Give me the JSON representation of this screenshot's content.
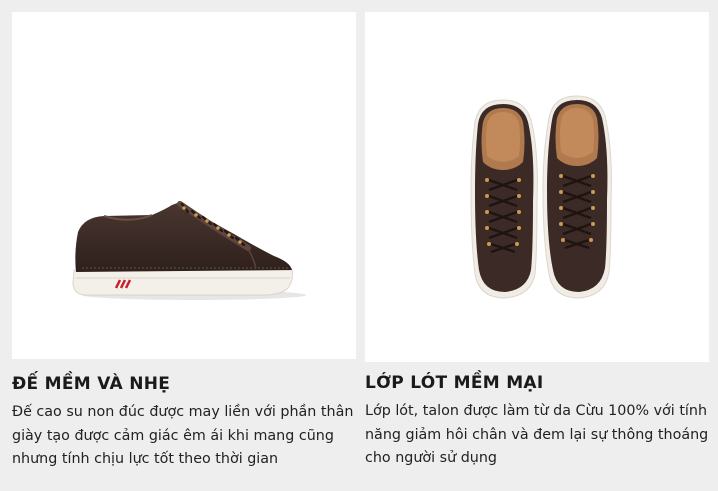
{
  "features": [
    {
      "title": "ĐẾ MỀM VÀ NHẸ",
      "description": "Đế cao su non đúc được may liền với phần thân giày tạo được cảm giác êm ái khi mang cũng nhưng tính chịu lực tốt theo thời gian",
      "image": "shoe-side-view"
    },
    {
      "title": "LỚP LÓT MỀM MẠI",
      "description": "Lớp lót, talon được làm từ da Cừu 100% với tính năng giảm hôi chân và đem lại sự thông thoáng cho người sử dụng",
      "image": "shoe-top-view"
    }
  ],
  "colors": {
    "page_bg": "#eeeeee",
    "photo_bg": "#ffffff",
    "leather": "#3a2a26",
    "sole": "#f2efe9",
    "stripe_red": "#c8202a"
  }
}
